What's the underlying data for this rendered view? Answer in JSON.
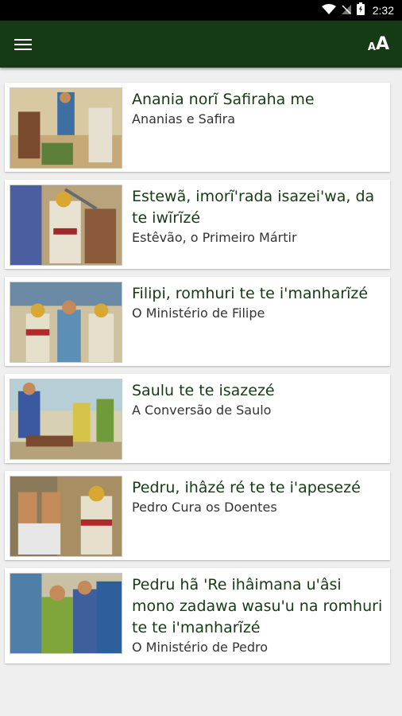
{
  "status_bar": {
    "time": "2:32",
    "icons": [
      "wifi-icon",
      "signal-off-icon",
      "battery-icon"
    ]
  },
  "app_bar": {
    "menu_icon": "hamburger-menu-icon",
    "font_size_label_small": "A",
    "font_size_label_big": "A"
  },
  "colors": {
    "app_bar": "#153b14",
    "title_text": "#153b14",
    "background": "#efefef"
  },
  "stories": [
    {
      "title": "Anania norĩ Safiraha me",
      "subtitle": "Ananias e Safira"
    },
    {
      "title": "Estewã, imorĩ'rada isazei'wa, da te iwĩrĩzé",
      "subtitle": "Estêvão, o Primeiro Mártir"
    },
    {
      "title": "Filipi, romhuri te te i'manharĩzé",
      "subtitle": "O Ministério de Filipe"
    },
    {
      "title": "Saulu te te isazezé",
      "subtitle": "A Conversão de Saulo"
    },
    {
      "title": "Pedru, ihâzé ré te te i'apesezé",
      "subtitle": "Pedro Cura os Doentes"
    },
    {
      "title": "Pedru hã 'Re ihâimana u'âsi mono zadawa wasu'u na romhuri te te i'manharĩzé",
      "subtitle": "O Ministério de Pedro"
    }
  ]
}
